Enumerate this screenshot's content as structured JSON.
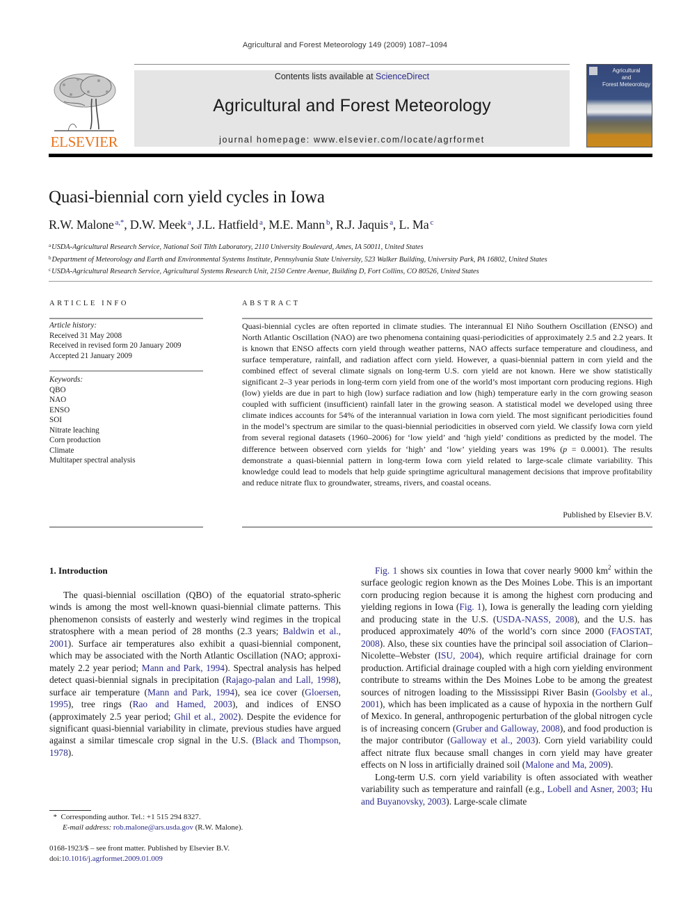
{
  "running_head": "Agricultural and Forest Meteorology 149 (2009) 1087–1094",
  "masthead": {
    "contents_prefix": "Contents lists available at ",
    "contents_link": "ScienceDirect",
    "journal_title": "Agricultural and Forest Meteorology",
    "homepage": "journal homepage: www.elsevier.com/locate/agrformet",
    "publisher_logo_text": "ELSEVIER",
    "cover_title_lines": [
      "Agricultural",
      "and",
      "Forest Meteorology"
    ]
  },
  "colors": {
    "link": "#2a2a8c",
    "elsevier_orange": "#e8731c",
    "masthead_bg": "#e5e5e5"
  },
  "article": {
    "title": "Quasi-biennial corn yield cycles in Iowa",
    "authors": [
      {
        "name": "R.W. Malone",
        "sup": "a,*"
      },
      {
        "name": "D.W. Meek",
        "sup": "a"
      },
      {
        "name": "J.L. Hatfield",
        "sup": "a"
      },
      {
        "name": "M.E. Mann",
        "sup": "b"
      },
      {
        "name": "R.J. Jaquis",
        "sup": "a"
      },
      {
        "name": "L. Ma",
        "sup": "c"
      }
    ],
    "affiliations": [
      {
        "key": "a",
        "text": "USDA-Agricultural Research Service, National Soil Tilth Laboratory, 2110 University Boulevard, Ames, IA 50011, United States"
      },
      {
        "key": "b",
        "text": "Department of Meteorology and Earth and Environmental Systems Institute, Pennsylvania State University, 523 Walker Building, University Park, PA 16802, United States"
      },
      {
        "key": "c",
        "text": "USDA-Agricultural Research Service, Agricultural Systems Research Unit, 2150 Centre Avenue, Building D, Fort Collins, CO 80526, United States"
      }
    ]
  },
  "article_info": {
    "heading": "ARTICLE INFO",
    "history_label": "Article history:",
    "history": [
      "Received 31 May 2008",
      "Received in revised form 20 January 2009",
      "Accepted 21 January 2009"
    ],
    "keywords_label": "Keywords:",
    "keywords": [
      "QBO",
      "NAO",
      "ENSO",
      "SOI",
      "Nitrate leaching",
      "Corn production",
      "Climate",
      "Multitaper spectral analysis"
    ]
  },
  "abstract": {
    "heading": "ABSTRACT",
    "text_1": "Quasi-biennial cycles are often reported in climate studies. The interannual El Niño Southern Oscillation (ENSO) and North Atlantic Oscillation (NAO) are two phenomena containing quasi-periodicities of approximately 2.5 and 2.2 years. It is known that ENSO affects corn yield through weather patterns, NAO affects surface temperature and cloudiness, and surface temperature, rainfall, and radiation affect corn yield. However, a quasi-biennial pattern in corn yield and the combined effect of several climate signals on long-term U.S. corn yield are not known. Here we show statistically significant 2–3 year periods in long-term corn yield from one of the world’s most important corn producing regions. High (low) yields are due in part to high (low) surface radiation and low (high) temperature early in the corn growing season coupled with sufficient (insufficient) rainfall later in the growing season. A statistical model we developed using three climate indices accounts for 54% of the interannual variation in Iowa corn yield. The most significant periodicities found in the model’s spectrum are similar to the quasi-biennial periodicities in observed corn yield. We classify Iowa corn yield from several regional datasets (1960–2006) for ‘low yield’ and ‘high yield’ conditions as predicted by the model. The difference between observed corn yields for ‘high’ and ‘low’ yielding years was 19% (",
    "p_var": "p",
    "text_2": " = 0.0001). The results demonstrate a quasi-biennial pattern in long-term Iowa corn yield related to large-scale climate variability. This knowledge could lead to models that help guide springtime agricultural management decisions that improve profitability and reduce nitrate flux to groundwater, streams, rivers, and coastal oceans.",
    "published_by": "Published by Elsevier B.V."
  },
  "introduction": {
    "heading": "1.  Introduction",
    "left_paragraph": [
      {
        "t": "The quasi-biennial oscillation (QBO) of the equatorial strato-spheric winds is among the most well-known quasi-biennial climate patterns. This phenomenon consists of easterly and westerly wind regimes in the tropical stratosphere with a mean period of 28 months (2.3 years; "
      },
      {
        "link": "Baldwin et al., 2001"
      },
      {
        "t": "). Surface air temperatures also exhibit a quasi-biennial component, which may be associated with the North Atlantic Oscillation (NAO; approxi-mately 2.2 year period; "
      },
      {
        "link": "Mann and Park, 1994"
      },
      {
        "t": "). Spectral analysis has helped detect quasi-biennial signals in precipitation ("
      },
      {
        "link": "Rajago-palan and Lall, 1998"
      },
      {
        "t": "), surface air temperature ("
      },
      {
        "link": "Mann and Park, 1994"
      },
      {
        "t": "), sea ice cover ("
      },
      {
        "link": "Gloersen, 1995"
      },
      {
        "t": "), tree rings ("
      },
      {
        "link": "Rao and Hamed, 2003"
      },
      {
        "t": "), and indices of ENSO (approximately 2.5 year period; "
      },
      {
        "link": "Ghil et al., 2002"
      },
      {
        "t": "). Despite the evidence for significant quasi-biennial variability in climate, previous studies have argued against a similar timescale crop signal in the U.S. ("
      },
      {
        "link": "Black and Thompson, 1978"
      },
      {
        "t": ")."
      }
    ],
    "right_paragraph_1": [
      {
        "link": "Fig. 1"
      },
      {
        "t": " shows six counties in Iowa that cover nearly 9000 km"
      },
      {
        "sup": "2"
      },
      {
        "t": " within the surface geologic region known as the Des Moines Lobe. This is an important corn producing region because it is among the highest corn producing and yielding regions in Iowa ("
      },
      {
        "link": "Fig. 1"
      },
      {
        "t": "), Iowa is generally the leading corn yielding and producing state in the U.S. ("
      },
      {
        "link": "USDA-NASS, 2008"
      },
      {
        "t": "), and the U.S. has produced approximately 40% of the world’s corn since 2000 ("
      },
      {
        "link": "FAOSTAT, 2008"
      },
      {
        "t": "). Also, these six counties have the principal soil association of Clarion–Nicolette–Webster ("
      },
      {
        "link": "ISU, 2004"
      },
      {
        "t": "), which require artificial drainage for corn production. Artificial drainage coupled with a high corn yielding environment contribute to streams within the Des Moines Lobe to be among the greatest sources of nitrogen loading to the Mississippi River Basin ("
      },
      {
        "link": "Goolsby et al., 2001"
      },
      {
        "t": "), which has been implicated as a cause of hypoxia in the northern Gulf of Mexico. In general, anthropogenic perturbation of the global nitrogen cycle is of increasing concern ("
      },
      {
        "link": "Gruber and Galloway, 2008"
      },
      {
        "t": "), and food production is the major contributor ("
      },
      {
        "link": "Galloway et al., 2003"
      },
      {
        "t": "). Corn yield variability could affect nitrate flux because small changes in corn yield may have greater effects on N loss in artificially drained soil ("
      },
      {
        "link": "Malone and Ma, 2009"
      },
      {
        "t": ")."
      }
    ],
    "right_paragraph_2": [
      {
        "t": "Long-term U.S. corn yield variability is often associated with weather variability such as temperature and rainfall (e.g., "
      },
      {
        "link": "Lobell and Asner, 2003"
      },
      {
        "t": "; "
      },
      {
        "link": "Hu and Buyanovsky, 2003"
      },
      {
        "t": "). Large-scale climate"
      }
    ]
  },
  "footnote": {
    "marker": "*",
    "corresponding": "Corresponding author. Tel.: +1 515 294 8327.",
    "email_label": "E-mail address:",
    "email": "rob.malone@ars.usda.gov",
    "email_suffix": "(R.W. Malone)."
  },
  "front_matter": {
    "issn_line": "0168-1923/$ – see front matter. Published by Elsevier B.V.",
    "doi_prefix": "doi:",
    "doi": "10.1016/j.agrformet.2009.01.009"
  }
}
